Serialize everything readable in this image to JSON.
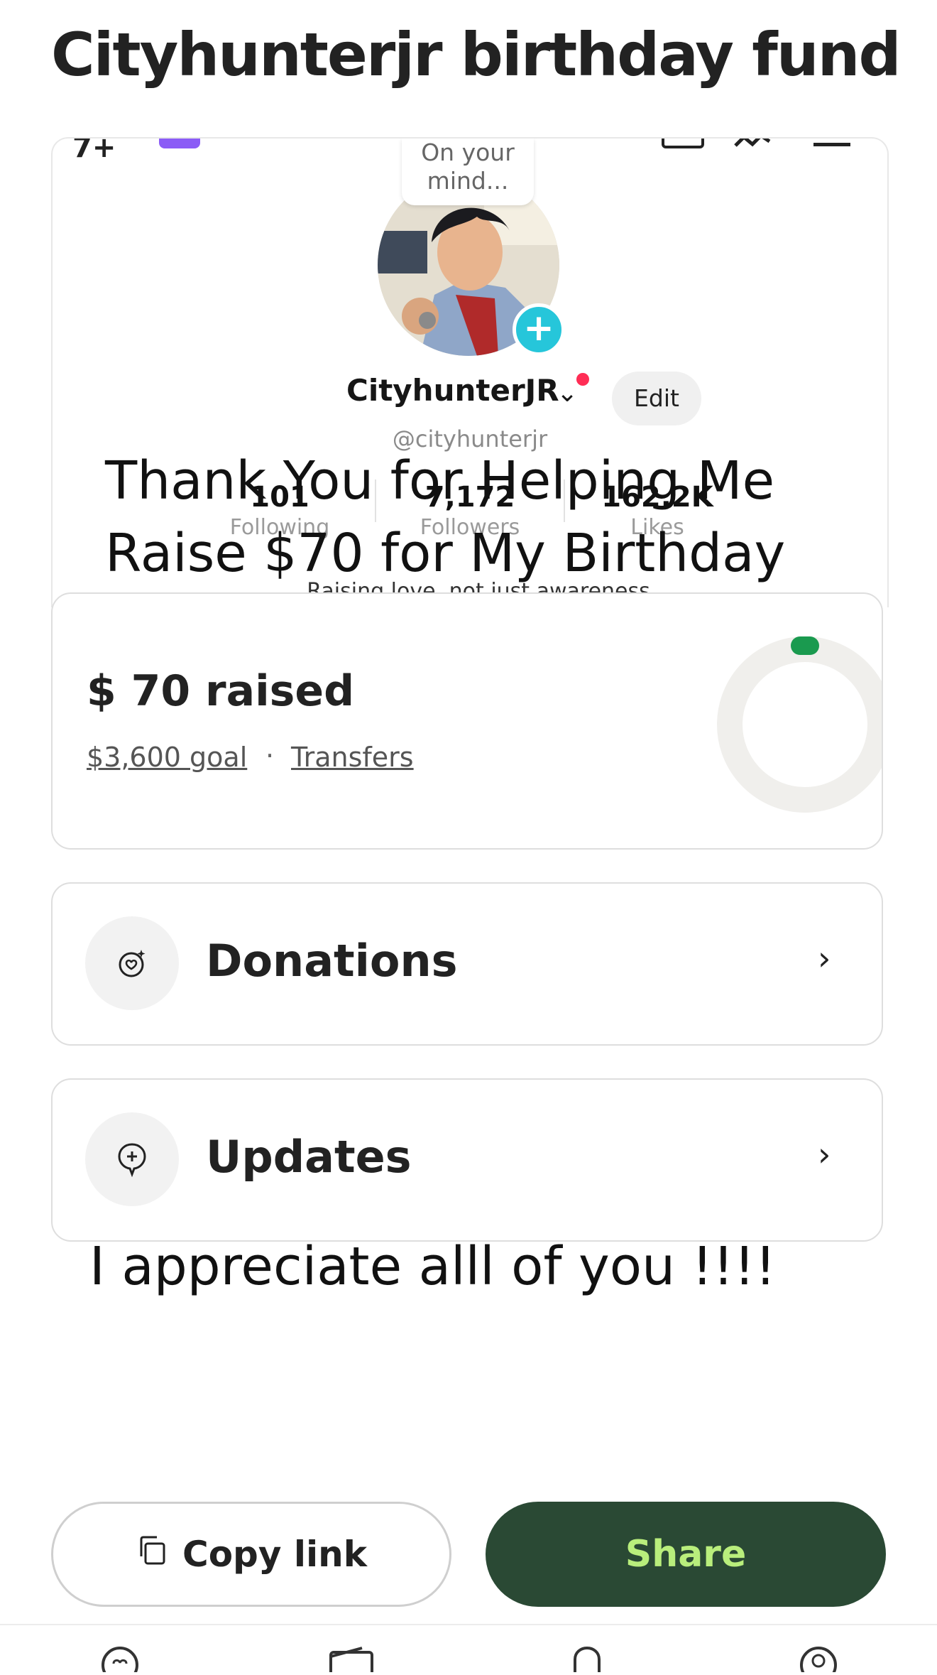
{
  "page": {
    "title": "Cityhunterjr birthday fund"
  },
  "embed": {
    "top_glyph": "7+",
    "bubble_text": "On your mind...",
    "username": "CityhunterJR",
    "edit_label": "Edit",
    "handle": "@cityhunterjr",
    "stats": [
      {
        "value": "101",
        "label": "Following"
      },
      {
        "value": "7,172",
        "label": "Followers"
      },
      {
        "value": "162.2K",
        "label": "Likes"
      }
    ],
    "bio": "Raising love, not just awareness",
    "overlay_line1": "Thank You for Helping Me",
    "overlay_line2": "Raise $70 for My Birthday"
  },
  "fund": {
    "raised_label": "$ 70 raised",
    "goal_link": "$3,600 goal",
    "separator": "·",
    "transfers_link": "Transfers",
    "progress_fraction": 0.019
  },
  "menu": {
    "donations_label": "Donations",
    "updates_label": "Updates"
  },
  "appreciate_text": "I appreciate alll of you !!!!",
  "actions": {
    "copy_label": "Copy link",
    "share_label": "Share"
  },
  "colors": {
    "share_bg": "#2a4934",
    "share_text": "#b9ee7c",
    "progress_green": "#1a9a4f",
    "avatar_add": "#26c6da",
    "notification": "#ff2d55"
  },
  "icons": {
    "copy": "copy-icon",
    "donations": "heart-sparkle-icon",
    "updates": "add-comment-icon",
    "chevron": "chevron-right-icon",
    "nav": [
      "heart-tab-icon",
      "wallet-tab-icon",
      "bell-tab-icon",
      "profile-tab-icon"
    ]
  }
}
